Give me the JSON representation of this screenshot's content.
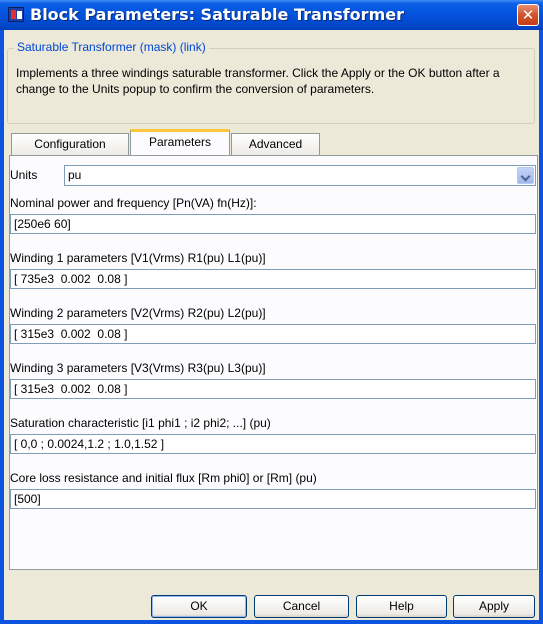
{
  "window": {
    "title": "Block Parameters: Saturable Transformer",
    "close_symbol": "✕"
  },
  "group": {
    "legend": "Saturable Transformer (mask) (link)",
    "description": "Implements a three windings saturable transformer. Click the Apply or the OK button after a change to the Units popup to confirm the conversion of parameters."
  },
  "tabs": [
    {
      "label": "Configuration",
      "active": false
    },
    {
      "label": "Parameters",
      "active": true
    },
    {
      "label": "Advanced",
      "active": false
    }
  ],
  "units": {
    "label": "Units",
    "value": "pu"
  },
  "params": [
    {
      "label": "Nominal power and frequency [Pn(VA) fn(Hz)]:",
      "value": "[250e6 60]"
    },
    {
      "label": "Winding 1 parameters [V1(Vrms) R1(pu) L1(pu)]",
      "value": "[ 735e3  0.002  0.08 ]"
    },
    {
      "label": "Winding 2 parameters [V2(Vrms) R2(pu) L2(pu)]",
      "value": "[ 315e3  0.002  0.08 ]"
    },
    {
      "label": "Winding 3 parameters [V3(Vrms) R3(pu) L3(pu)]",
      "value": "[ 315e3  0.002  0.08 ]"
    },
    {
      "label": "Saturation characteristic [i1 phi1 ; i2 phi2; ...] (pu)",
      "value": "[ 0,0 ; 0.0024,1.2 ; 1.0,1.52 ]"
    },
    {
      "label": "Core loss resistance and initial flux [Rm phi0] or [Rm] (pu)",
      "value": "[500]"
    }
  ],
  "buttons": {
    "ok": "OK",
    "cancel": "Cancel",
    "help": "Help",
    "apply": "Apply"
  }
}
